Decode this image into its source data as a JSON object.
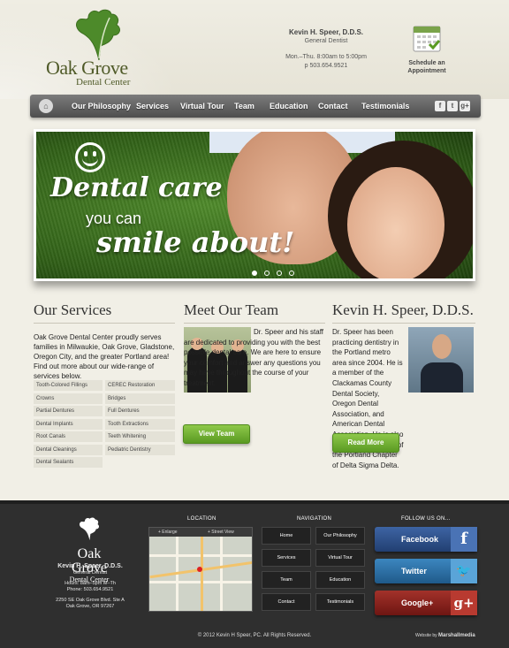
{
  "logo": {
    "line1": "Oak Grove",
    "line2": "Dental Center"
  },
  "header": {
    "name": "Kevin H. Speer, D.D.S.",
    "title": "General Dentist",
    "hours": "Mon.–Thu. 8:00am to 5:00pm",
    "phone": "p 503.654.9521",
    "schedule_label": "Schedule an Appointment"
  },
  "nav": {
    "items": [
      "Our Philosophy",
      "Services",
      "Virtual Tour",
      "Team",
      "Education",
      "Contact",
      "Testimonials"
    ],
    "social": [
      "f",
      "t",
      "g+"
    ]
  },
  "hero": {
    "line1": "Dental care",
    "line2": "you can",
    "line3": "smile about!",
    "slide_count": 4,
    "active_slide": 1
  },
  "services": {
    "heading": "Our Services",
    "intro": "Oak Grove Dental Center proudly serves families in Milwaukie, Oak Grove, Gladstone, Oregon City, and the greater Portland area! Find out more about our wide-range of services below.",
    "left": [
      "Tooth-Colored Fillings",
      "Crowns",
      "Partial Dentures",
      "Dental Implants",
      "Root Canals",
      "Dental Cleanings",
      "Dental Sealants"
    ],
    "right": [
      "CEREC Restoration",
      "Bridges",
      "Full Dentures",
      "Tooth Extractions",
      "Teeth Whitening",
      "Pediatric Dentistry"
    ]
  },
  "team": {
    "heading": "Meet Our Team",
    "text": "Dr. Speer and his staff are dedicated to providing you with the best possible dental care. We are here to ensure your comfort and answer any questions you may have throughout the course of your treatment.",
    "button": "View Team"
  },
  "doctor": {
    "heading": "Kevin H. Speer, D.D.S.",
    "text": "Dr. Speer has been practicing dentistry in the Portland metro area since 2004. He is a member of the Clackamas County Dental Society, Oregon Dental Association, and American Dental Association. He is also the former president of the Portland Chapter of Delta Sigma Delta.",
    "button": "Read More"
  },
  "footer": {
    "logo1": "Oak Grove",
    "logo2": "Dental Center",
    "name": "Kevin H. Speer, D.D.S.",
    "title": "General Dentist",
    "hours": "Hours: 8am–5pm M–Th",
    "phone": "Phone: 503.654.9521",
    "address1": "2250 SE Oak Grove Blvd. Ste A",
    "address2": "Oak Grove, OR 97267",
    "location_heading": "LOCATION",
    "map_enlarge": "+ Enlarge",
    "map_street": "+ Street View",
    "navigation_heading": "NAVIGATION",
    "nav_items": [
      "Home",
      "Our Philosophy",
      "Services",
      "Virtual Tour",
      "Team",
      "Education",
      "Contact",
      "Testimonials"
    ],
    "follow_heading": "FOLLOW US ON...",
    "social": [
      "Facebook",
      "Twitter",
      "Google+"
    ],
    "social_colors": [
      "#2b4f8a",
      "#2d6ea3",
      "#8a1f1a"
    ],
    "copyright": "© 2012 Kevin H Speer, PC. All Rights Reserved.",
    "website_by": "Website by",
    "website_brand": "Marshallmedia"
  }
}
